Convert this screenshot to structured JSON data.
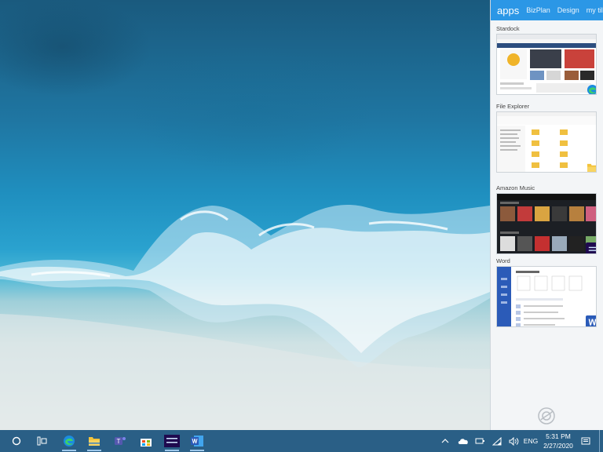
{
  "panel": {
    "tabs": [
      {
        "label": "apps",
        "active": true
      },
      {
        "label": "BizPlan"
      },
      {
        "label": "Design"
      },
      {
        "label": "my tiles"
      }
    ],
    "apps": [
      {
        "label": "Stardock",
        "icon": "edge-icon"
      },
      {
        "label": "File Explorer",
        "icon": "folder-icon"
      },
      {
        "label": "Amazon Music",
        "icon": "amazon-music-icon"
      },
      {
        "label": "Word",
        "icon": "word-icon"
      }
    ]
  },
  "taskbar": {
    "pinned": [
      {
        "name": "start-icon"
      },
      {
        "name": "task-view-icon"
      },
      {
        "name": "edge-icon",
        "running": true
      },
      {
        "name": "file-explorer-icon",
        "running": true
      },
      {
        "name": "teams-icon"
      },
      {
        "name": "store-icon"
      },
      {
        "name": "amazon-music-icon",
        "running": true
      },
      {
        "name": "word-icon",
        "running": true
      }
    ],
    "tray": {
      "language": "ENG",
      "time": "5:31 PM",
      "date": "2/27/2020"
    }
  },
  "colors": {
    "taskbar": "#2a5f86",
    "panel_header": "#2b97e6",
    "word": "#2b5bb8",
    "amazon_music": "#1f0a4f"
  }
}
